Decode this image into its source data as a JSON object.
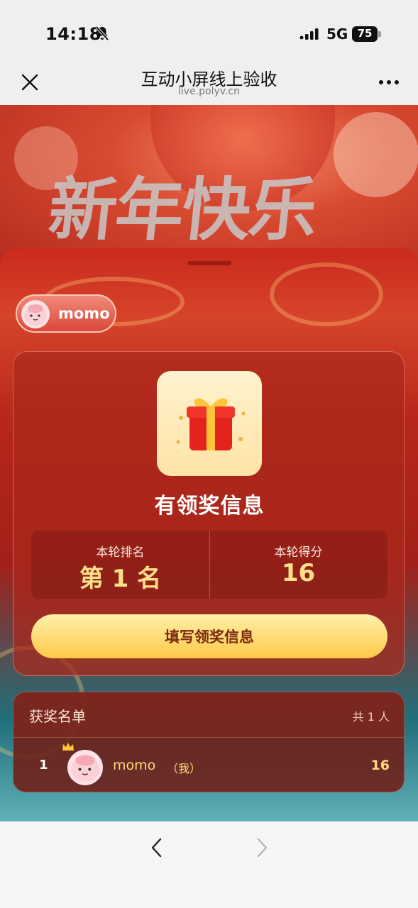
{
  "status_bar": {
    "time": "14:18",
    "network": "5G",
    "battery": "75",
    "icons": [
      "bell-slash-icon",
      "signal-icon",
      "battery-icon"
    ]
  },
  "nav": {
    "title": "互动小屏线上验收",
    "url": "live.polyv.cn",
    "icons": [
      "close-icon",
      "more-icon"
    ]
  },
  "banner": {
    "text": "新年快乐"
  },
  "user": {
    "name": "momo"
  },
  "prize_card": {
    "title": "有领奖信息",
    "rank_label": "本轮排名",
    "rank_value": "第 1 名",
    "score_label": "本轮得分",
    "score_value": "16",
    "button_label": "填写领奖信息"
  },
  "winners": {
    "title": "获奖名单",
    "count": "共 1 人",
    "rows": [
      {
        "rank": "1",
        "name": "momo",
        "me_tag": "（我）",
        "score": "16"
      }
    ]
  },
  "toolbar": {
    "icons": [
      "back-arrow-icon",
      "forward-arrow-icon"
    ]
  },
  "colors": {
    "accent_gold": "#ffd97a",
    "card_red": "#aa281c",
    "button_yellow": "#ffc948"
  }
}
